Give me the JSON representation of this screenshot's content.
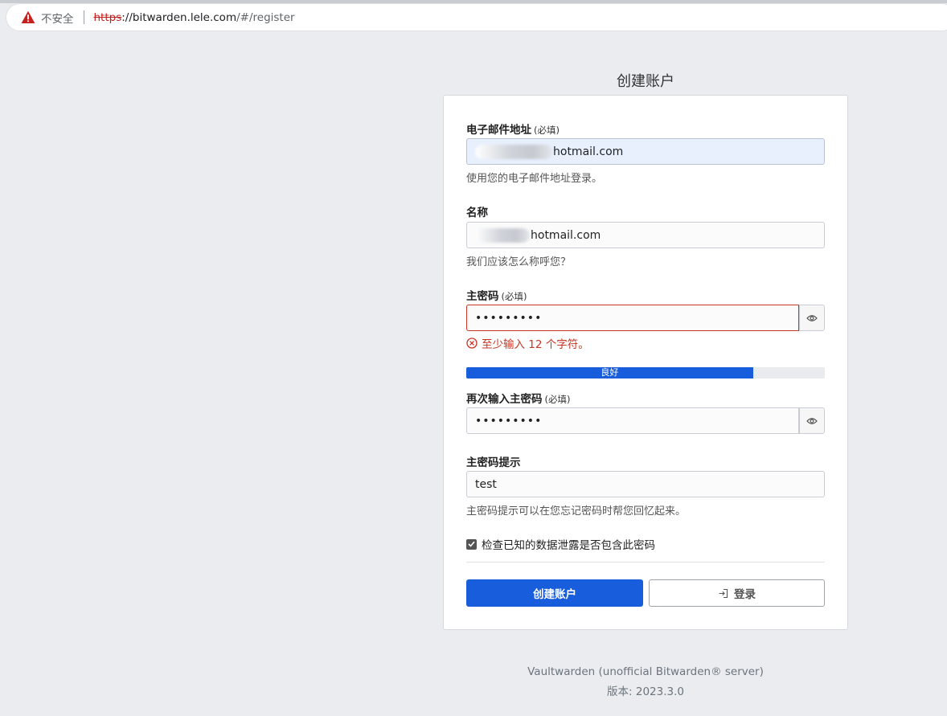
{
  "browser": {
    "insecure_label": "不安全",
    "url_scheme": "https",
    "url_host": "://bitwarden.lele.com",
    "url_path": "/#/register"
  },
  "page": {
    "title": "创建账户"
  },
  "form": {
    "email": {
      "label": "电子邮件地址",
      "required": "(必填)",
      "value": "hotmail.com",
      "help": "使用您的电子邮件地址登录。"
    },
    "name": {
      "label": "名称",
      "value": "hotmail.com",
      "help": "我们应该怎么称呼您？"
    },
    "master_password": {
      "label": "主密码",
      "required": "(必填)",
      "value": "•••••••••",
      "error": "至少输入 12 个字符。"
    },
    "strength": {
      "label": "良好",
      "fraction": 0.8
    },
    "confirm_password": {
      "label": "再次输入主密码",
      "required": "(必填)",
      "value": "•••••••••"
    },
    "hint": {
      "label": "主密码提示",
      "value": "test",
      "help": "主密码提示可以在您忘记密码时帮您回忆起来。"
    },
    "breach_check": {
      "label": "检查已知的数据泄露是否包含此密码",
      "checked": true
    }
  },
  "actions": {
    "create_label": "创建账户",
    "login_label": "登录"
  },
  "footer": {
    "line1": "Vaultwarden (unofficial Bitwarden® server)",
    "line2": "版本: 2023.3.0"
  },
  "colors": {
    "primary": "#175ddc",
    "danger": "#c83522",
    "background": "#eaecf0"
  },
  "icons": [
    "warning-icon",
    "eye-icon",
    "error-circle-icon",
    "check-icon",
    "sign-in-icon"
  ]
}
